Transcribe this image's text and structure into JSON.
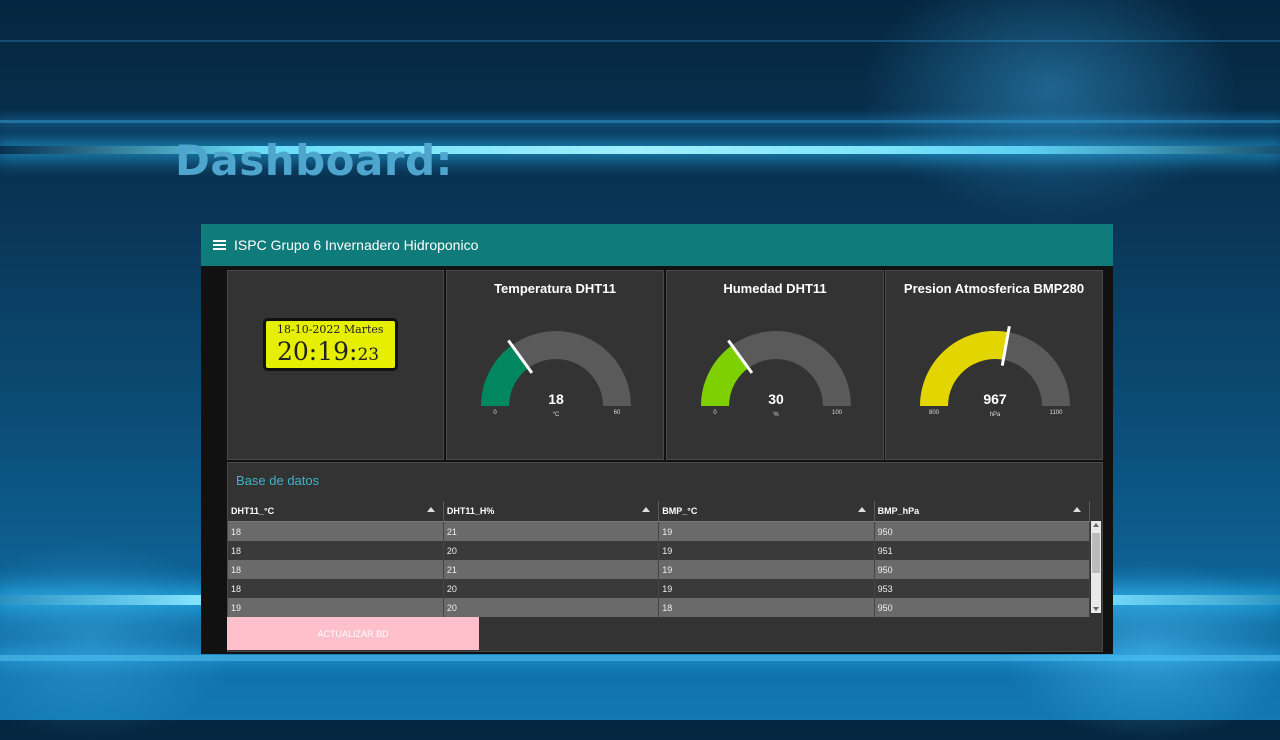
{
  "slide": {
    "title": "Dashboard:"
  },
  "app": {
    "header_title": "ISPC Grupo 6 Invernadero Hidroponico",
    "menu_icon": "hamburger-menu-icon"
  },
  "clock": {
    "date": "18-10-2022 Martes",
    "time_hm": "20:19:",
    "time_sec": "23",
    "bg_color": "#e7ef00"
  },
  "gauges": [
    {
      "title": "Temperatura DHT11",
      "value": 18,
      "value_label": "18",
      "unit": "°C",
      "min": 0,
      "max": 60,
      "min_label": "0",
      "max_label": "60",
      "color": "#00875f"
    },
    {
      "title": "Humedad DHT11",
      "value": 30,
      "value_label": "30",
      "unit": "%",
      "min": 0,
      "max": 100,
      "min_label": "0",
      "max_label": "100",
      "color": "#7ed000"
    },
    {
      "title": "Presion Atmosferica BMP280",
      "value": 967,
      "value_label": "967",
      "unit": "hPa",
      "min": 800,
      "max": 1100,
      "min_label": "800",
      "max_label": "1100",
      "color": "#e3d600"
    }
  ],
  "database": {
    "title": "Base de datos",
    "columns": [
      "DHT11_°C",
      "DHT11_H%",
      "BMP_°C",
      "BMP_hPa"
    ],
    "rows": [
      [
        "18",
        "21",
        "19",
        "950"
      ],
      [
        "18",
        "20",
        "19",
        "951"
      ],
      [
        "18",
        "21",
        "19",
        "950"
      ],
      [
        "18",
        "20",
        "19",
        "953"
      ],
      [
        "19",
        "20",
        "18",
        "950"
      ]
    ]
  },
  "button": {
    "label": "ACTUALIZAR BD",
    "color": "#ffc0cb"
  }
}
